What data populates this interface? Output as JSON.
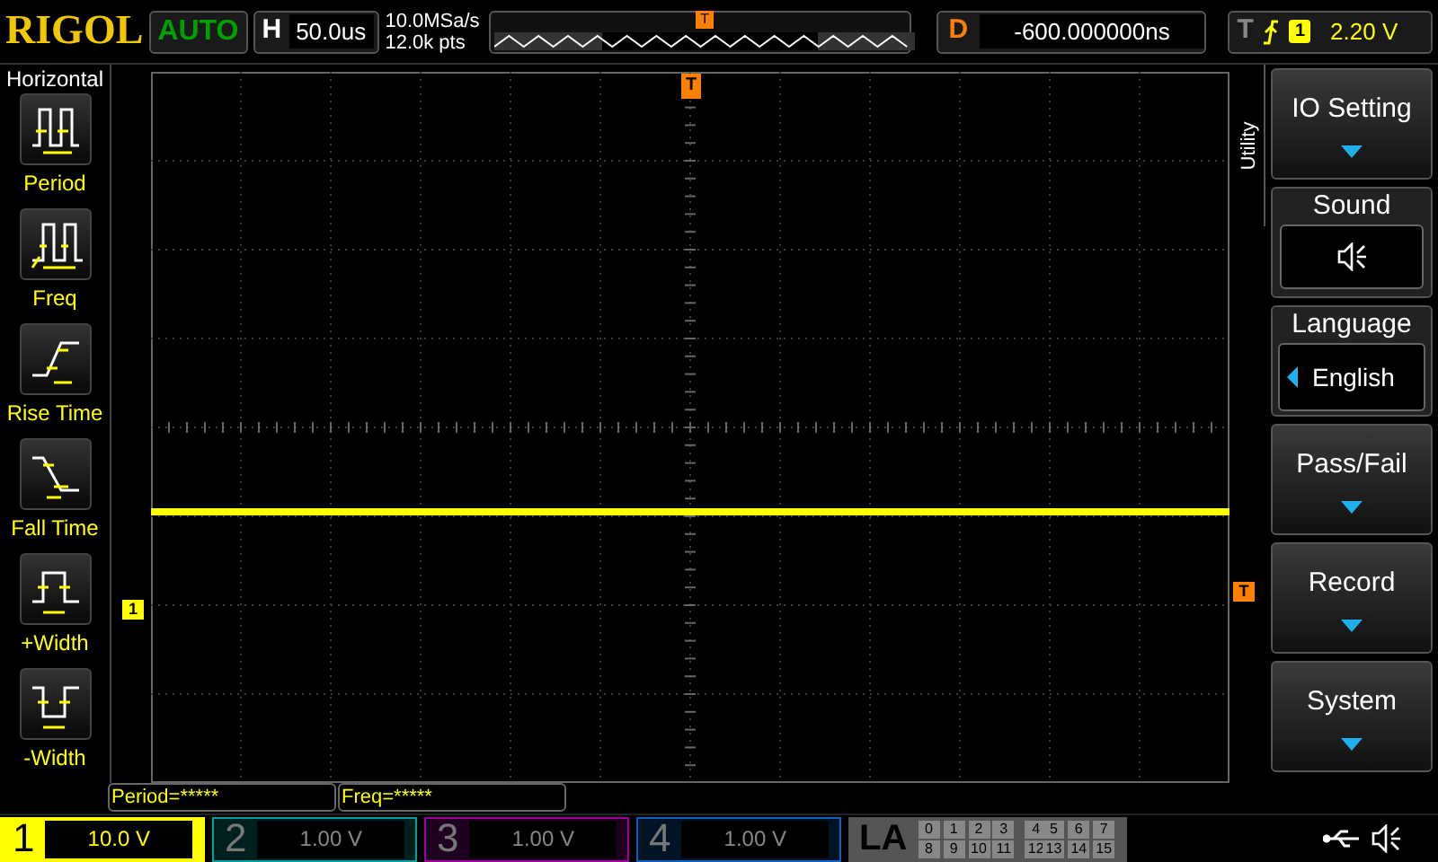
{
  "top_bar": {
    "logo": "RIGOL",
    "run_status": "AUTO",
    "horizontal": {
      "label": "H",
      "value": "50.0us"
    },
    "sample_rate": "10.0MSa/s",
    "memory_depth": "12.0k pts",
    "trigger_position_marker": "T",
    "delay": {
      "label": "D",
      "value": "-600.000000ns"
    },
    "trigger": {
      "label": "T",
      "source": "1",
      "level": "2.20 V"
    }
  },
  "left_menu": {
    "title": "Horizontal",
    "items": [
      {
        "label": "Period"
      },
      {
        "label": "Freq"
      },
      {
        "label": "Rise Time"
      },
      {
        "label": "Fall Time"
      },
      {
        "label": "+Width"
      },
      {
        "label": "-Width"
      }
    ]
  },
  "graticule": {
    "channel_marker": "1",
    "trigger_level_marker": "T",
    "trigger_position_marker": "T"
  },
  "right_menu": {
    "tab": "Utility",
    "items": [
      {
        "kind": "submenu",
        "label": "IO Setting"
      },
      {
        "kind": "icon",
        "label": "Sound"
      },
      {
        "kind": "select",
        "label": "Language",
        "value": "English"
      },
      {
        "kind": "submenu",
        "label": "Pass/Fail"
      },
      {
        "kind": "submenu",
        "label": "Record"
      },
      {
        "kind": "submenu",
        "label": "System"
      }
    ]
  },
  "measurements": [
    "Period=*****",
    "Freq=*****"
  ],
  "channels": [
    {
      "number": "1",
      "scale": "10.0 V",
      "selected": true,
      "color": "#ffff00"
    },
    {
      "number": "2",
      "scale": "1.00 V",
      "selected": false,
      "color": "#00a0a0"
    },
    {
      "number": "3",
      "scale": "1.00 V",
      "selected": false,
      "color": "#a000a0"
    },
    {
      "number": "4",
      "scale": "1.00 V",
      "selected": false,
      "color": "#1060c0"
    }
  ],
  "logic_analyzer": {
    "label": "LA",
    "bits": [
      "0",
      "1",
      "2",
      "3",
      "4",
      "5",
      "6",
      "7",
      "8",
      "9",
      "10",
      "11",
      "12",
      "13",
      "14",
      "15"
    ]
  }
}
